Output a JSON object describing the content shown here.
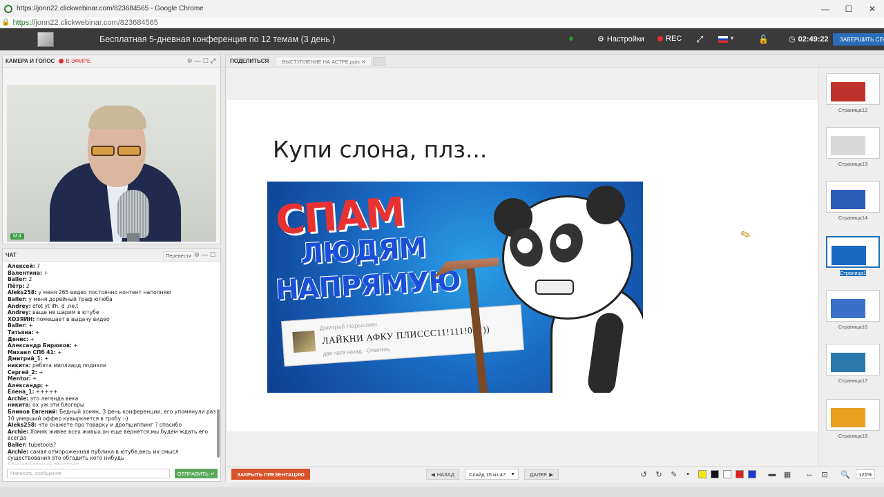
{
  "browser": {
    "tab_title": "https://jonn22.clickwebinar.com/823684565 - Google Chrome",
    "url_https": "https://",
    "url_rest": "jonn22.clickwebinar.com/823684565"
  },
  "header": {
    "title": "Бесплатная 5-дневная конференция по 12 темам (3 день )",
    "settings": "Настройки",
    "rec": "REC",
    "timer": "02:49:22",
    "finish": "ЗАВЕРШИТЬ СЕССИЮ"
  },
  "camera": {
    "title": "КАМЕРА И ГОЛОС",
    "live": "В ЭФИРЕ",
    "badge": "M:4"
  },
  "chat": {
    "title": "ЧАТ",
    "translate": "Перевести",
    "messages": [
      {
        "user": "Алексей:",
        "text": " 7"
      },
      {
        "user": "Валентина:",
        "text": " +"
      },
      {
        "user": "Baller:",
        "text": " 2"
      },
      {
        "user": "Пётр:",
        "text": " 2"
      },
      {
        "user": "Aleks258:",
        "text": " у меня 265 видео постоянно контент наполняю"
      },
      {
        "user": "Baller:",
        "text": " у меня дорейный траф ютюба"
      },
      {
        "user": "Andrey:",
        "text": " dfot yt ifh. d .ne,t"
      },
      {
        "user": "Andrey:",
        "text": " ваще не шарим в ютубе"
      },
      {
        "user": "ХОЗЯИН:",
        "text": " помещает в выдачу видео"
      },
      {
        "user": "Baller:",
        "text": " +"
      },
      {
        "user": "Татьяна:",
        "text": " +"
      },
      {
        "user": "Денис:",
        "text": " +"
      },
      {
        "user": "Александр Бирюков:",
        "text": " +"
      },
      {
        "user": "Михаил СПб 41:",
        "text": " +"
      },
      {
        "user": "Дмитрий_1:",
        "text": " +"
      },
      {
        "user": "никита:",
        "text": " ребята миллиард подняли"
      },
      {
        "user": "Сергей_2:",
        "text": " +"
      },
      {
        "user": "Mentor:",
        "text": " +"
      },
      {
        "user": "Александр:",
        "text": " +"
      },
      {
        "user": "Елена_1:",
        "text": " +++++"
      },
      {
        "user": "Archie:",
        "text": " это легенда века"
      },
      {
        "user": "никита:",
        "text": " ох уж эти блогеры"
      },
      {
        "user": "Блинов Евгений:",
        "text": " Бедный хомяк, 3 день конференции, его упомянули раз 10 умерший оффер кувыркается в гробу :-)"
      },
      {
        "user": "Aleks258:",
        "text": " что скажете про товарку и дропшиппинг ? спасибо"
      },
      {
        "user": "Archie:",
        "text": " Хомяк живее всех живых,он еще вернется,мы будем ждать его всегда"
      },
      {
        "user": "Baller:",
        "text": " tubetools?"
      },
      {
        "user": "Archie:",
        "text": " самая отмороженная публика в ютубе,весь их смысл существования это обгадить кого нибудь"
      }
    ],
    "typing": "Блинов Евгений печатает",
    "input_placeholder": "Написать сообщение",
    "send": "ОТПРАВИТЬ"
  },
  "main": {
    "share": "ПОДЕЛИТЬСЯ",
    "file_tab": "ВЫСТУПЛЕНИЕ НА АСТРЕ.pptx",
    "slide": {
      "title": "Купи слона, плз...",
      "img_line1": "СПАМ",
      "img_line2": "ЛЮДЯМ",
      "img_line3": "НАПРЯМУЮ",
      "comment_name": "Дмитрий Нарышкин",
      "comment_text": "ЛАЙКНИ АФКУ ПЛИССС11!111!0!!!))",
      "comment_meta": "два часа назад · Ответить"
    },
    "thumbnails": [
      {
        "label": "Страница12",
        "color": "#c0302a"
      },
      {
        "label": "Страница13",
        "color": "#d8d8d8"
      },
      {
        "label": "Страница14",
        "color": "#2a5cb8"
      },
      {
        "label": "Страница15",
        "color": "#1a6ac4"
      },
      {
        "label": "Страница16",
        "color": "#3a70c8"
      },
      {
        "label": "Страница17",
        "color": "#2a7ab0"
      },
      {
        "label": "Страница18",
        "color": "#e8a020"
      }
    ],
    "toolbar": {
      "close": "ЗАКРЫТЬ ПРЕЗЕНТАЦИЮ",
      "prev": "НАЗАД",
      "slide_select": "Слайд 15 из 47",
      "next": "ДАЛЕЕ",
      "zoom": "121%",
      "colors": [
        "#f5e800",
        "#111111",
        "#ffffff",
        "#e02020",
        "#1a3adc"
      ]
    }
  }
}
